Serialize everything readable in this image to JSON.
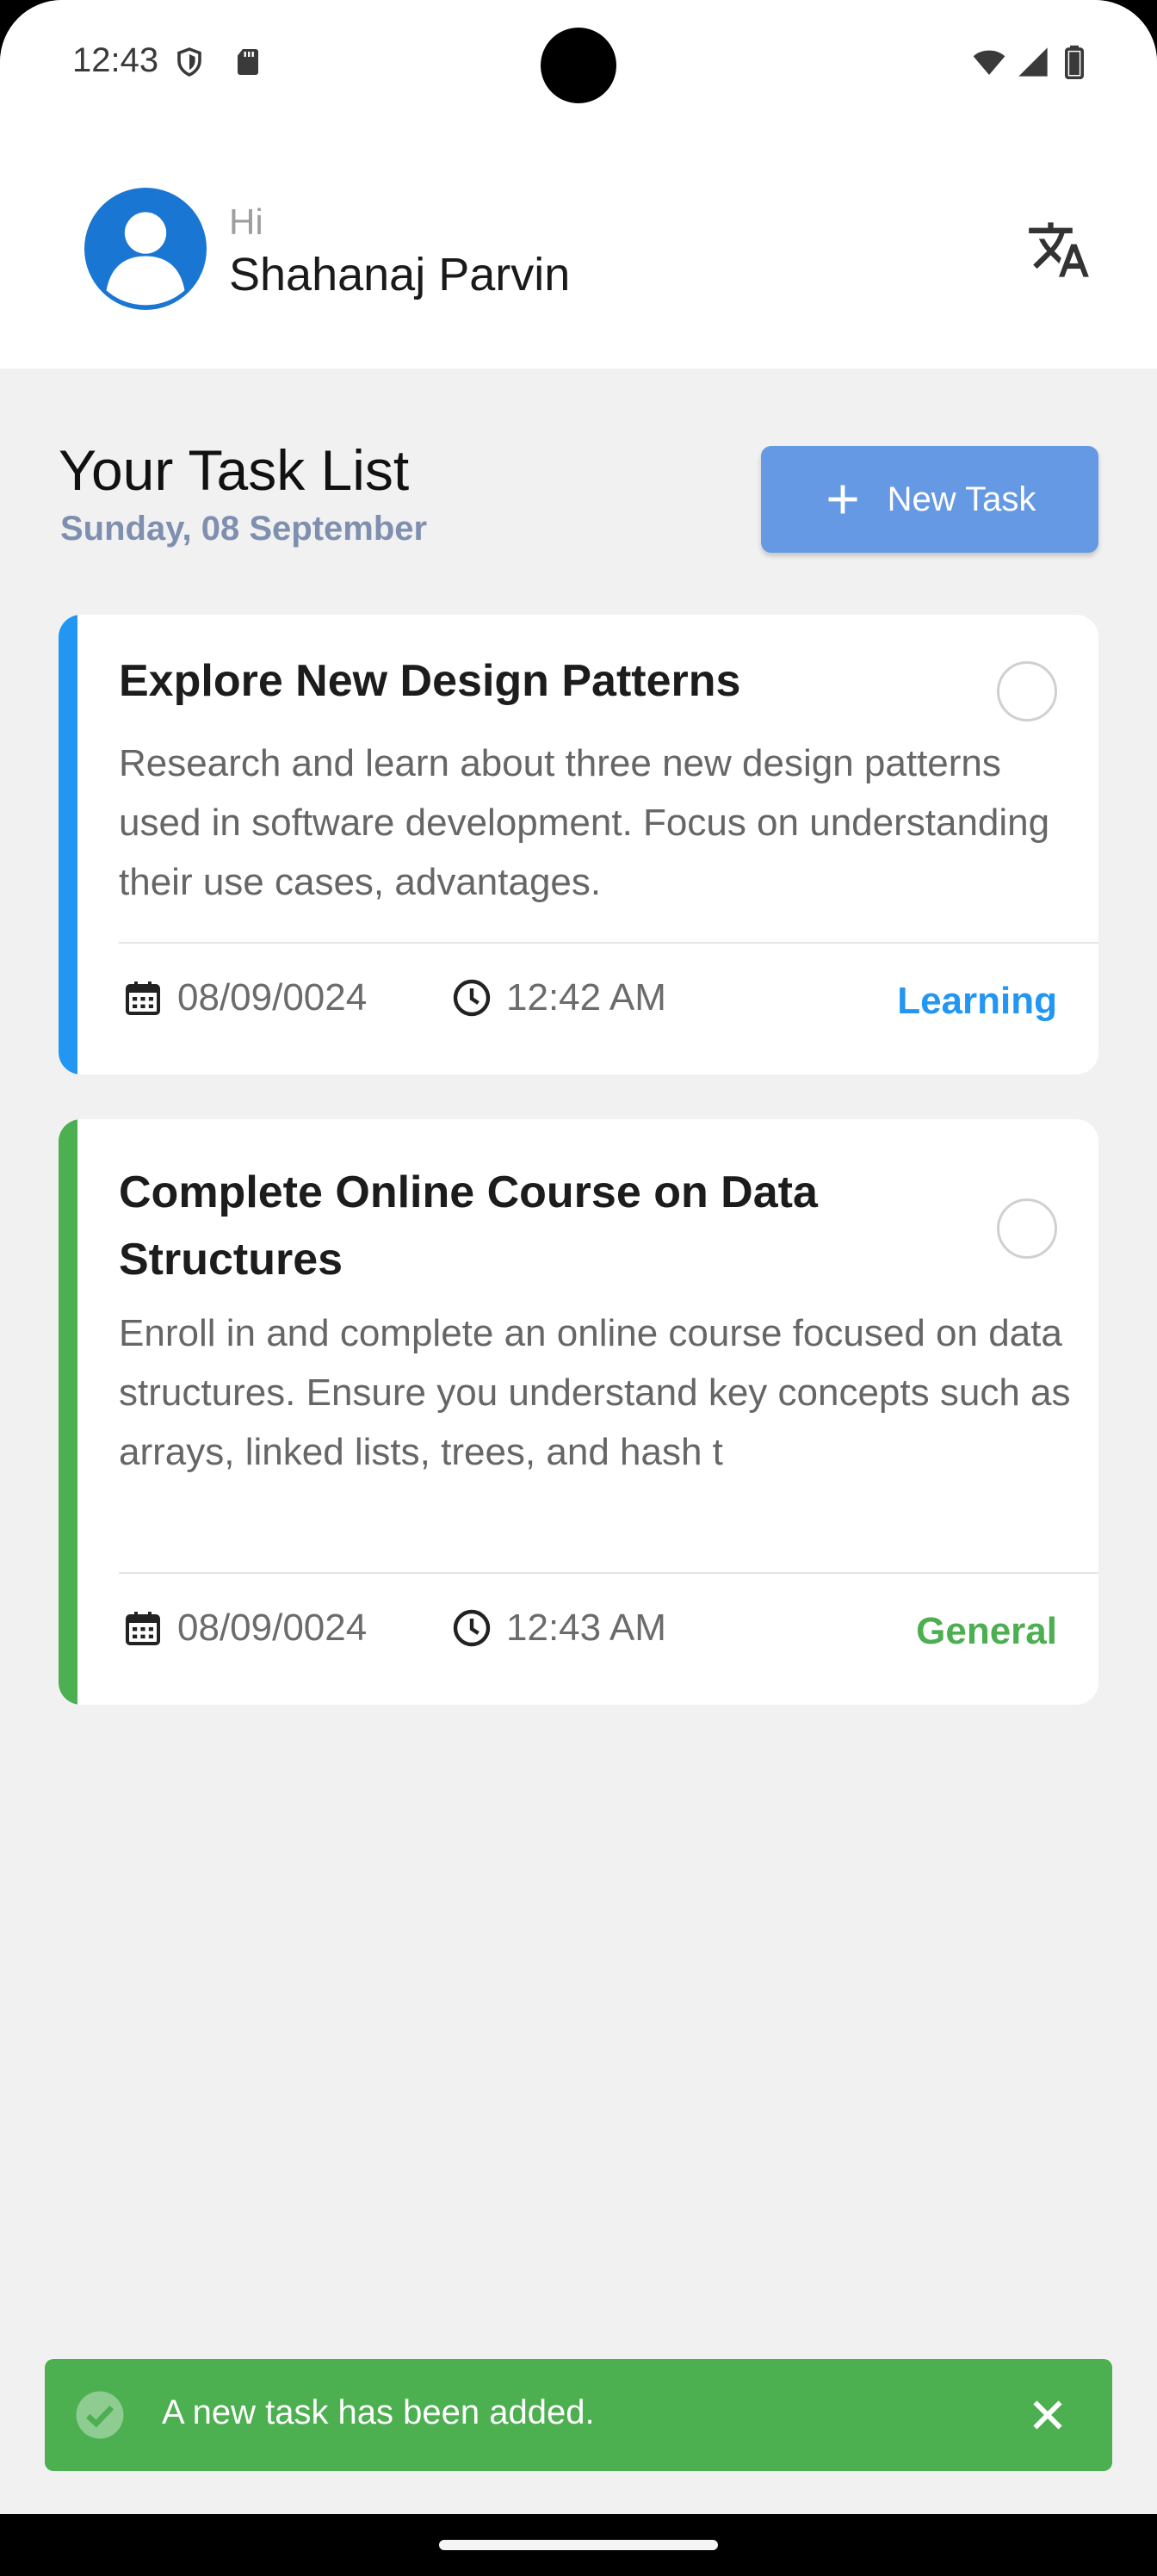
{
  "status_bar": {
    "time": "12:43",
    "icons": [
      "shield-icon",
      "sd-card-icon",
      "wifi-icon",
      "signal-icon",
      "battery-icon"
    ]
  },
  "header": {
    "greeting": "Hi",
    "user_name": "Shahanaj Parvin",
    "avatar_icon": "person-icon",
    "translate_icon": "translate-icon"
  },
  "task_list": {
    "title": "Your Task List",
    "date": "Sunday, 08 September",
    "new_task_label": "New Task"
  },
  "tasks": [
    {
      "title": "Explore New Design Patterns",
      "description": "Research and learn about three new design patterns used in software development. Focus on understanding their use cases, advantages.",
      "date": "08/09/0024",
      "time": "12:42 AM",
      "category": "Learning",
      "accent_color": "#2196f3",
      "completed": false
    },
    {
      "title": "Complete Online Course on Data Structures",
      "description": "Enroll in and complete an online course focused on data structures. Ensure you understand key concepts such as arrays, linked lists, trees, and hash t",
      "date": "08/09/0024",
      "time": "12:43 AM",
      "category": "General",
      "accent_color": "#4caf50",
      "completed": false
    }
  ],
  "snackbar": {
    "message": "A new task has been added.",
    "color": "#4caf50"
  },
  "colors": {
    "primary_button": "#6699e3",
    "date_subtitle": "#7f8fb0",
    "avatar": "#1976d2"
  }
}
